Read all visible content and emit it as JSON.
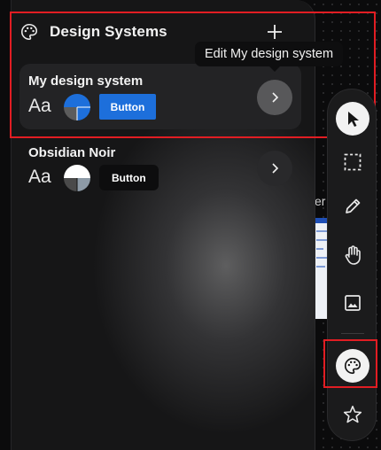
{
  "panel": {
    "title": "Design Systems",
    "tooltip": "Edit My design system"
  },
  "systems": [
    {
      "name": "My design system",
      "typography_sample": "Aa",
      "button_label": "Button",
      "button_color": "#1d6fdb",
      "swatch_colors": [
        "#1d6fdb",
        "#5c5c5c",
        "#1d6fdb",
        "#ffffff"
      ]
    },
    {
      "name": "Obsidian Noir",
      "typography_sample": "Aa",
      "button_label": "Button",
      "button_color": "#0d0d0e",
      "swatch_colors": [
        "#ffffff",
        "#4a4a4a",
        "#8d9aa6",
        "#0d0d0e"
      ]
    }
  ],
  "background_peek": {
    "text": "er"
  },
  "toolbar": {
    "tools": [
      "cursor-icon",
      "marquee-select-icon",
      "pencil-icon",
      "hand-icon",
      "image-icon",
      "palette-icon",
      "star-icon"
    ],
    "active": [
      "cursor-icon",
      "palette-icon"
    ]
  },
  "colors": {
    "accent": "#1d6fdb",
    "highlight": "#e11d23",
    "panel_bg": "#161617",
    "card_bg": "#232325"
  }
}
